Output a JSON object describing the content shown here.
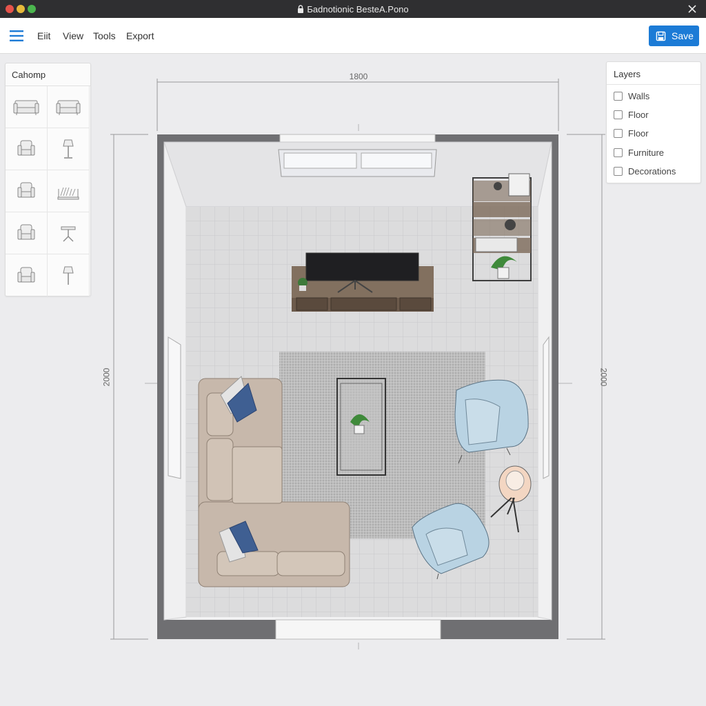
{
  "window": {
    "title": "Бadnotionic BesteA.Pono",
    "colors": {
      "close": "#e5534b",
      "minimize": "#e7b93a",
      "maximize": "#4bb64e"
    }
  },
  "menubar": {
    "items": [
      "Eiit",
      "View",
      "Tools",
      "Export"
    ],
    "save_label": "Save",
    "accent": "#1c7bd6"
  },
  "catalog": {
    "title": "Cahomp",
    "items": [
      "sofa-icon",
      "loveseat-icon",
      "armchair-icon",
      "floor-lamp-icon",
      "armchair-icon",
      "bookshelf-icon",
      "armchair-icon",
      "side-table-icon",
      "armchair-icon",
      "floor-lamp-icon"
    ]
  },
  "layers": {
    "title": "Layers",
    "items": [
      {
        "label": "Walls",
        "checked": false
      },
      {
        "label": "Floor",
        "checked": false
      },
      {
        "label": "Floor",
        "checked": false
      },
      {
        "label": "Furniture",
        "checked": false
      },
      {
        "label": "Decorations",
        "checked": false
      }
    ]
  },
  "dimensions": {
    "width": "1800",
    "height_left": "2000",
    "height_right": "2000"
  }
}
